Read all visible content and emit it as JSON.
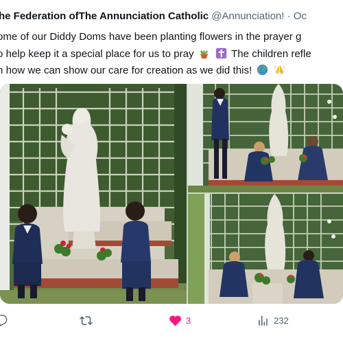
{
  "tweet": {
    "author": "he Federation ofThe Annunciation Catholic",
    "handle": "@Annunciation!",
    "separator": "·",
    "time": "Oc",
    "lines": [
      "ome of our Diddy Doms have been planting  flowers  in the prayer g",
      "o help keep it a special place for us to pray",
      "n how we can show our care for creation as we did this!"
    ],
    "line2_tail": "The  children  refle",
    "emoji": [
      "potted-plant",
      "latin-cross",
      "globe",
      "folded-hands"
    ]
  },
  "media": {
    "photos": [
      "prayer-garden-statue-two-children",
      "prayer-garden-four-children",
      "prayer-garden-two-children-kneeling"
    ]
  },
  "actions": {
    "reply_count": "",
    "retweet_count": "",
    "like_count": "3",
    "views_count": "232"
  },
  "colors": {
    "text": "#0f1419",
    "secondary": "#536471",
    "like": "#f91880"
  }
}
